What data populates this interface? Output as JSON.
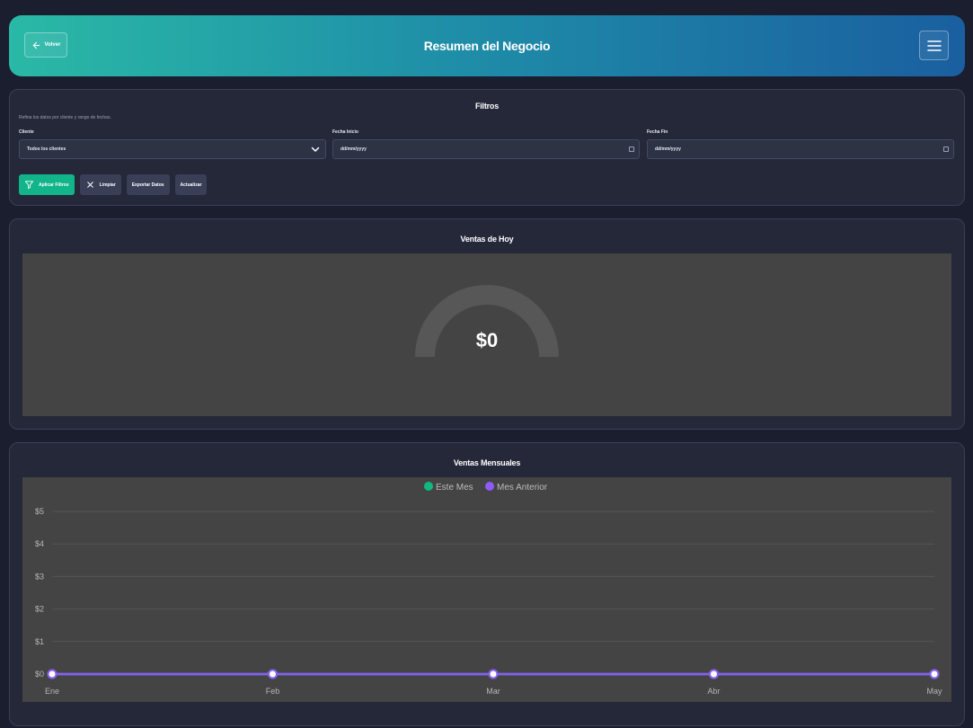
{
  "header": {
    "back_label": "Volver",
    "title": "Resumen del Negocio"
  },
  "filters": {
    "title": "Filtros",
    "subtitle": "Refina los datos por cliente y rango de fechas.",
    "client_label": "Cliente",
    "client_value": "Todos los clientes",
    "start_label": "Fecha Inicio",
    "start_placeholder": "dd/mm/yyyy",
    "end_label": "Fecha Fin",
    "end_placeholder": "dd/mm/yyyy",
    "apply_label": "Aplicar Filtros",
    "clear_label": "Limpiar",
    "export_label": "Exportar Datos",
    "refresh_label": "Actualizar"
  },
  "today": {
    "title": "Ventas de Hoy",
    "value": "$0"
  },
  "monthly": {
    "title": "Ventas Mensuales"
  },
  "colors": {
    "accent_green": "#12b48a",
    "series_purple": "#8b5cf6"
  },
  "chart_data": {
    "type": "line",
    "categories": [
      "Ene",
      "Feb",
      "Mar",
      "Abr",
      "May"
    ],
    "series": [
      {
        "name": "Este Mes",
        "values": [
          0,
          0,
          0,
          0,
          0
        ],
        "color": "#10b981"
      },
      {
        "name": "Mes Anterior",
        "values": [
          0,
          0,
          0,
          0,
          0
        ],
        "color": "#8b5cf6"
      }
    ],
    "ylim": [
      0,
      5
    ],
    "yticks": [
      "$0",
      "$1",
      "$2",
      "$3",
      "$4",
      "$5"
    ],
    "grid": true,
    "legend": "top"
  }
}
